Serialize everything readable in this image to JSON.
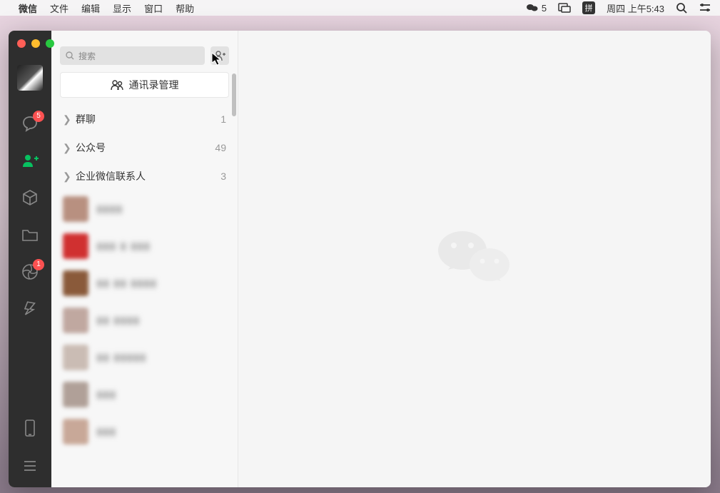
{
  "menubar": {
    "app": "微信",
    "items": [
      "文件",
      "编辑",
      "显示",
      "窗口",
      "帮助"
    ],
    "right": {
      "imeCount": "5",
      "imeBadge": "拼",
      "datetime": "周四 上午5:43"
    }
  },
  "search": {
    "placeholder": "搜索"
  },
  "manage": {
    "label": "通讯录管理"
  },
  "sections": [
    {
      "name": "群聊",
      "count": "1"
    },
    {
      "name": "公众号",
      "count": "49"
    },
    {
      "name": "企业微信联系人",
      "count": "3"
    }
  ],
  "rail": {
    "chatBadge": "5",
    "momentsBadge": "1"
  },
  "contacts": [
    {
      "nm": "▮▮▮▮",
      "pic": "#b89080"
    },
    {
      "nm": "▮▮▮ ▮ ▮▮▮",
      "pic": "#d03030"
    },
    {
      "nm": "▮▮ ▮▮ ▮▮▮▮",
      "pic": "#8a5a3a"
    },
    {
      "nm": "▮▮ ▮▮▮▮",
      "pic": "#c0a8a0"
    },
    {
      "nm": "▮▮ ▮▮▮▮▮",
      "pic": "#cabcb4"
    },
    {
      "nm": "▮▮▮",
      "pic": "#b0a098"
    },
    {
      "nm": "▮▮▮",
      "pic": "#c8a898"
    }
  ]
}
